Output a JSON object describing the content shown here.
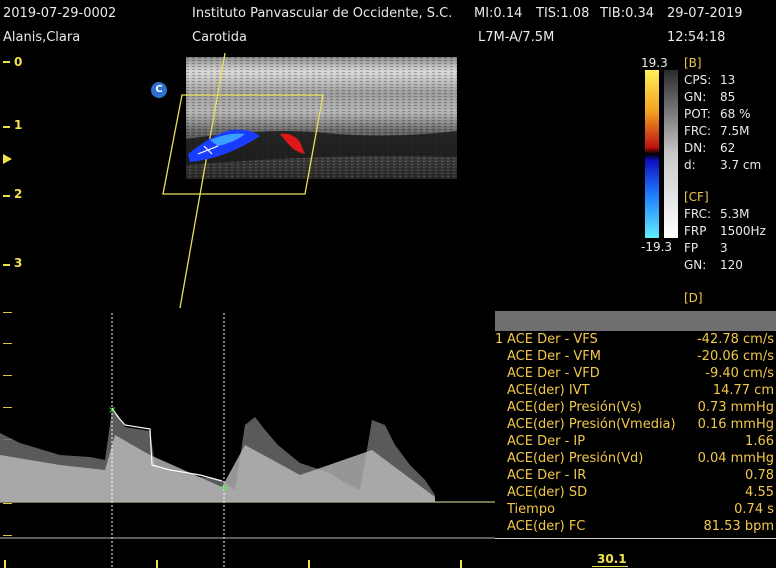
{
  "header": {
    "patient_id": "2019-07-29-0002",
    "institution": "Instituto Panvascular de Occidente, S.C.",
    "mi": "MI:0.14",
    "tis": "TIS:1.08",
    "tib": "TIB:0.34",
    "date": "29-07-2019",
    "patient_name": "Alanis,Clara",
    "exam": "Carotida",
    "probe": "L7M-A/7.5M",
    "time": "12:54:18"
  },
  "depth_scale": {
    "labels": [
      "0",
      "1",
      "2",
      "3"
    ]
  },
  "image_badge": "C",
  "color_bar": {
    "top": "19.3",
    "bottom": "-19.3"
  },
  "params": {
    "b_header": "[B]",
    "b": [
      {
        "k": "CPS:",
        "v": "13"
      },
      {
        "k": "GN:",
        "v": "85"
      },
      {
        "k": "POT:",
        "v": "68 %"
      },
      {
        "k": "FRC:",
        "v": "7.5M"
      },
      {
        "k": "DN:",
        "v": "62"
      },
      {
        "k": "d:",
        "v": "3.7 cm"
      }
    ],
    "cf_header": "[CF]",
    "cf": [
      {
        "k": "FRC:",
        "v": "5.3M"
      },
      {
        "k": "FRP",
        "v": "1500Hz"
      },
      {
        "k": "FP",
        "v": "3"
      },
      {
        "k": "GN:",
        "v": "120"
      }
    ],
    "d_header": "[D]"
  },
  "measurements": {
    "index": "1",
    "rows": [
      {
        "label": "ACE Der - VFS",
        "value": "-42.78 cm/s"
      },
      {
        "label": "ACE Der - VFM",
        "value": "-20.06 cm/s"
      },
      {
        "label": "ACE Der - VFD",
        "value": "-9.40 cm/s"
      },
      {
        "label": "ACE(der) IVT",
        "value": "14.77 cm"
      },
      {
        "label": "ACE(der) Presión(Vs)",
        "value": "0.73 mmHg"
      },
      {
        "label": "ACE(der) Presión(Vmedia)",
        "value": "0.16 mmHg"
      },
      {
        "label": "ACE Der - IP",
        "value": "1.66"
      },
      {
        "label": "ACE(der) Presión(Vd)",
        "value": "0.04 mmHg"
      },
      {
        "label": "ACE Der - IR",
        "value": "0.78"
      },
      {
        "label": "ACE(der) SD",
        "value": "4.55"
      },
      {
        "label": "Tiempo",
        "value": "0.74 s"
      },
      {
        "label": "ACE(der) FC",
        "value": "81.53 bpm"
      }
    ]
  },
  "sweep_speed": "30.1",
  "colors": {
    "accent": "#f2e24a",
    "table": "#f2c84a",
    "flow_red": "#e02020",
    "flow_blue": "#2040ff"
  }
}
